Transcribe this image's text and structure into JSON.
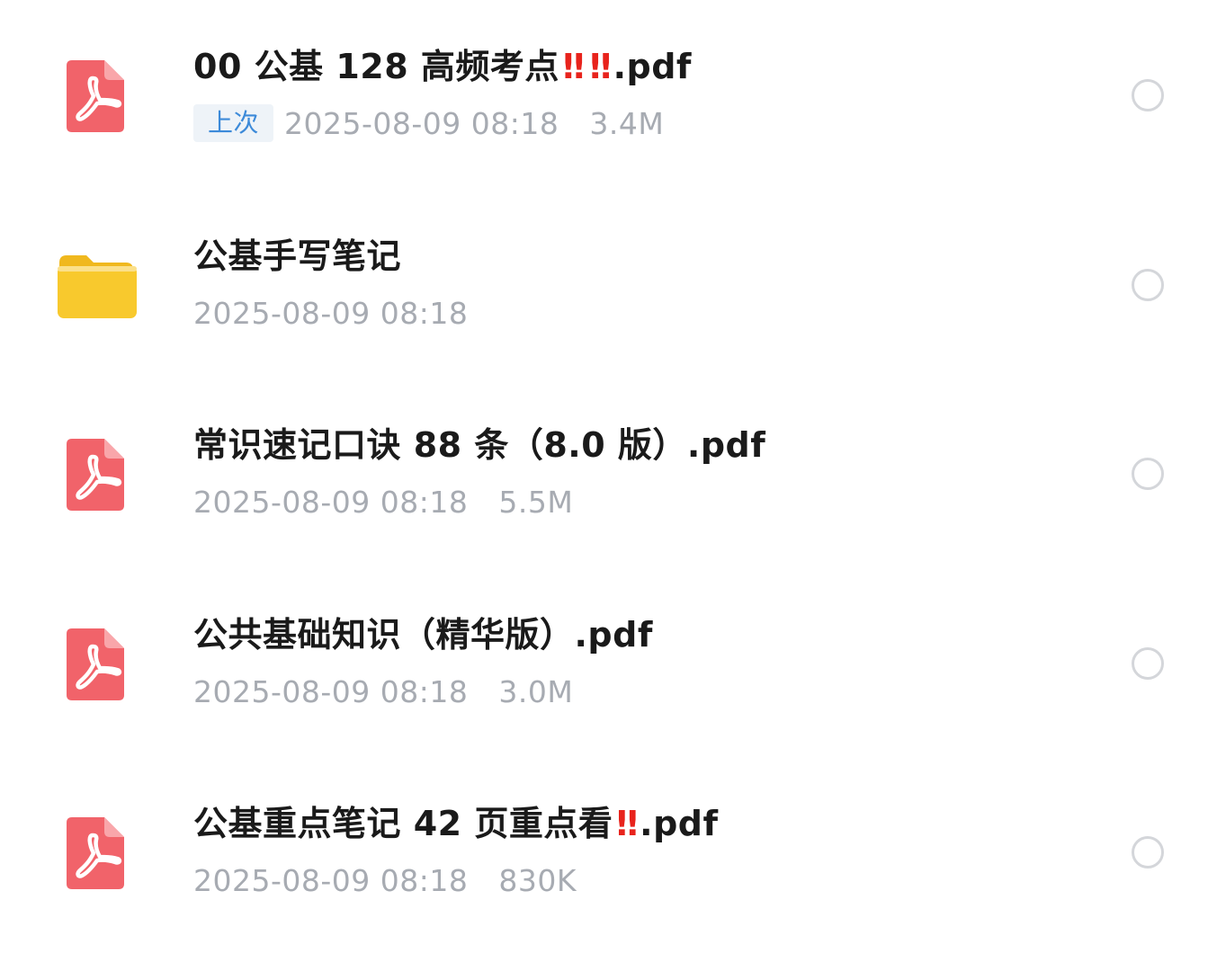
{
  "colors": {
    "pdf_icon": "#f1636a",
    "folder_icon": "#f8c92d",
    "badge_text": "#3c8ad9",
    "warning_mark": "#e8231c",
    "meta_text": "#a7abb2"
  },
  "files": [
    {
      "icon": "pdf-icon",
      "name_prefix": "00 公基 128 高频考点",
      "marks": [
        "‼",
        "‼"
      ],
      "name_suffix": ".pdf",
      "badge": "上次",
      "date": "2025-08-09 08:18",
      "size": "3.4M"
    },
    {
      "icon": "folder-icon",
      "name_prefix": "公基手写笔记",
      "marks": [],
      "name_suffix": "",
      "badge": "",
      "date": "2025-08-09 08:18",
      "size": ""
    },
    {
      "icon": "pdf-icon",
      "name_prefix": "常识速记口诀 88 条（8.0 版）.pdf",
      "marks": [],
      "name_suffix": "",
      "badge": "",
      "date": "2025-08-09 08:18",
      "size": "5.5M"
    },
    {
      "icon": "pdf-icon",
      "name_prefix": "公共基础知识（精华版）.pdf",
      "marks": [],
      "name_suffix": "",
      "badge": "",
      "date": "2025-08-09 08:18",
      "size": "3.0M"
    },
    {
      "icon": "pdf-icon",
      "name_prefix": "公基重点笔记 42 页重点看",
      "marks": [
        "‼"
      ],
      "name_suffix": ".pdf",
      "badge": "",
      "date": "2025-08-09 08:18",
      "size": "830K"
    }
  ]
}
